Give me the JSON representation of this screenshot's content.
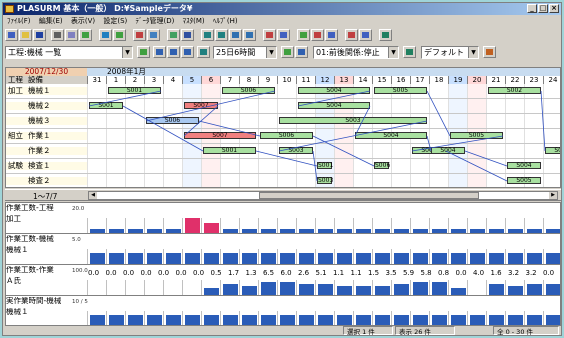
{
  "window": {
    "title": "PLASURM 基本（一般）  D:¥Sampleデータ¥",
    "controls": [
      "_",
      "□",
      "×"
    ]
  },
  "menu": [
    "ﾌｧｲﾙ(F)",
    "編集(E)",
    "表示(V)",
    "設定(S)",
    "ﾃﾞｰﾀ管理(D)",
    "ﾏｽﾀ(M)",
    "ﾍﾙﾌﾟ(H)"
  ],
  "toolbar2": {
    "view_combo": "工程:機械 一覧",
    "span_combo": "25日6時間",
    "relation_combo": "01:前後関係:停止",
    "style_combo": "デフォルト"
  },
  "gantt": {
    "header_date": "2007/12/30",
    "month_label": "2008年1月",
    "col_process": "工程",
    "col_equipment": "設備",
    "days": [
      "31",
      "1",
      "2",
      "3",
      "4",
      "5",
      "6",
      "7",
      "8",
      "9",
      "10",
      "11",
      "12",
      "13",
      "14",
      "15",
      "16",
      "17",
      "18",
      "19",
      "20",
      "21",
      "22",
      "23",
      "24"
    ],
    "saturday_color": "#c8e0ff",
    "sunday_color": "#ffd8d8",
    "rows": [
      {
        "process": "加工",
        "equipment": "機械１"
      },
      {
        "process": "",
        "equipment": "機械２"
      },
      {
        "process": "",
        "equipment": "機械３"
      },
      {
        "process": "組立",
        "equipment": "作業１"
      },
      {
        "process": "",
        "equipment": "作業２"
      },
      {
        "process": "試験",
        "equipment": "検査１"
      },
      {
        "process": "",
        "equipment": "検査２"
      }
    ],
    "bars": [
      {
        "row": 0,
        "start": 1,
        "len": 3,
        "label": "S001",
        "color": "#a8e0a0"
      },
      {
        "row": 0,
        "start": 7,
        "len": 3,
        "label": "S006",
        "color": "#a8e0a0"
      },
      {
        "row": 0,
        "start": 11,
        "len": 4,
        "label": "S004",
        "color": "#a8e0a0"
      },
      {
        "row": 0,
        "start": 15,
        "len": 3,
        "label": "S005",
        "color": "#a8e0a0"
      },
      {
        "row": 0,
        "start": 21,
        "len": 3,
        "label": "S002",
        "color": "#a8e0a0"
      },
      {
        "row": 1,
        "start": 0,
        "len": 2,
        "label": "S001",
        "color": "#a8e0a0"
      },
      {
        "row": 1,
        "start": 5,
        "len": 2,
        "label": "S007",
        "color": "#f08080"
      },
      {
        "row": 1,
        "start": 11,
        "len": 4,
        "label": "S004",
        "color": "#a8e0a0"
      },
      {
        "row": 2,
        "start": 3,
        "len": 3,
        "label": "S006",
        "color": "#a8c8f0"
      },
      {
        "row": 2,
        "start": 10,
        "len": 8,
        "label": "S003",
        "color": "#a8e0a0"
      },
      {
        "row": 3,
        "start": 5,
        "len": 4,
        "label": "S007",
        "color": "#f08080"
      },
      {
        "row": 3,
        "start": 9,
        "len": 3,
        "label": "S006",
        "color": "#a8e0a0"
      },
      {
        "row": 3,
        "start": 14,
        "len": 4,
        "label": "S004",
        "color": "#a8e0a0"
      },
      {
        "row": 3,
        "start": 19,
        "len": 3,
        "label": "S005",
        "color": "#a8e0a0"
      },
      {
        "row": 4,
        "start": 6,
        "len": 3,
        "label": "S001",
        "color": "#a8e0a0"
      },
      {
        "row": 4,
        "start": 10,
        "len": 2,
        "label": "S003",
        "color": "#a8e0a0"
      },
      {
        "row": 4,
        "start": 17,
        "len": 2,
        "label": "S005",
        "color": "#a8e0a0"
      },
      {
        "row": 4,
        "start": 18,
        "len": 2,
        "label": "S004",
        "color": "#a8e0a0"
      },
      {
        "row": 4,
        "start": 24,
        "len": 2,
        "label": "S002",
        "color": "#a8e0a0"
      },
      {
        "row": 5,
        "start": 12,
        "len": 1,
        "label": "S001",
        "color": "#a8e0a0"
      },
      {
        "row": 5,
        "start": 15,
        "len": 1,
        "label": "S006",
        "color": "#a8e0a0"
      },
      {
        "row": 5,
        "start": 22,
        "len": 2,
        "label": "S004",
        "color": "#a8e0a0"
      },
      {
        "row": 6,
        "start": 12,
        "len": 1,
        "label": "S003",
        "color": "#a8e0a0"
      },
      {
        "row": 6,
        "start": 22,
        "len": 2,
        "label": "S005",
        "color": "#a8e0a0"
      }
    ]
  },
  "divider": {
    "range": "1〜7/7"
  },
  "load": [
    {
      "title": "作業工数-工程",
      "sub": "加工",
      "scale": "20.0",
      "values": [
        0.2,
        0.2,
        0.2,
        0.2,
        0.2,
        0.7,
        0.45,
        0.2,
        0.2,
        0.2,
        0.2,
        0.2,
        0.2,
        0.2,
        0.2,
        0.2,
        0.2,
        0.2,
        0.2,
        0.2,
        0.2,
        0.2,
        0.2,
        0.2,
        0.2
      ],
      "hot": [
        5,
        6
      ]
    },
    {
      "title": "作業工数-機械",
      "sub": "機械１",
      "scale": "5.0",
      "values": [
        0.5,
        0.5,
        0.5,
        0.5,
        0.5,
        0.5,
        0.5,
        0.5,
        0.5,
        0.5,
        0.5,
        0.5,
        0.5,
        0.5,
        0.5,
        0.5,
        0.5,
        0.5,
        0.5,
        0.5,
        0.5,
        0.5,
        0.5,
        0.5,
        0.5
      ],
      "hot": []
    },
    {
      "title": "作業工数-作業",
      "sub": "Ａ氏",
      "scale": "100.0",
      "nums": [
        "0.0",
        "0.0",
        "0.0",
        "0.0",
        "0.0",
        "0.0",
        "0.0",
        "0.5",
        "1.7",
        "1.3",
        "6.5",
        "6.0",
        "2.6",
        "5.1",
        "1.1",
        "1.1",
        "1.5",
        "3.5",
        "5.9",
        "5.8",
        "0.8",
        "0.0",
        "4.0",
        "1.6",
        "3.2",
        "3.2",
        "0.0"
      ],
      "values": [
        0,
        0,
        0,
        0,
        0,
        0,
        0.3,
        0.5,
        0.4,
        0.6,
        0.6,
        0.5,
        0.5,
        0.4,
        0.4,
        0.4,
        0.5,
        0.6,
        0.6,
        0.3,
        0,
        0.5,
        0.4,
        0.5,
        0.5
      ],
      "hot": []
    },
    {
      "title": "実作業時間-機械",
      "sub": "機械１",
      "scale": "10 / 5",
      "values": [
        0.5,
        0.5,
        0.5,
        0.5,
        0.5,
        0.5,
        0.5,
        0.5,
        0.5,
        0.5,
        0.5,
        0.5,
        0.5,
        0.5,
        0.5,
        0.5,
        0.5,
        0.5,
        0.5,
        0.5,
        0.5,
        0.5,
        0.5,
        0.5,
        0.5
      ],
      "hot": []
    }
  ],
  "status": {
    "selected": "選択 1 件",
    "shown": "表示 26 件",
    "total": "全 0 - 30 件"
  }
}
